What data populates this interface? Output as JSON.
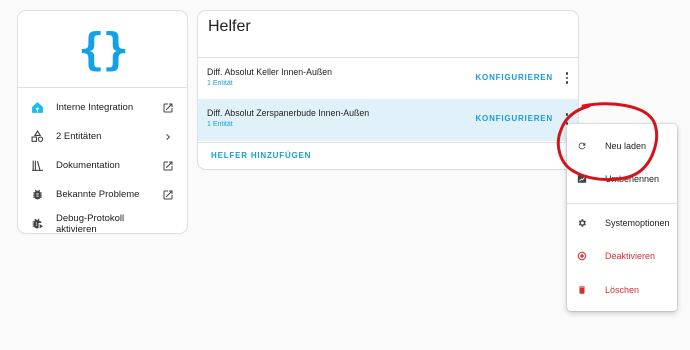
{
  "left_card": {
    "logo_text": "{}",
    "items": [
      {
        "label": "Interne Integration",
        "icon": "home-assistant-icon",
        "trailing": "open-external-icon"
      },
      {
        "label": "2 Entitäten",
        "icon": "shapes-icon",
        "trailing": "chevron-right-icon"
      },
      {
        "label": "Dokumentation",
        "icon": "book-icon",
        "trailing": "open-external-icon"
      },
      {
        "label": "Bekannte Probleme",
        "icon": "bug-icon",
        "trailing": "open-external-icon"
      },
      {
        "label": "Debug-Protokoll aktivieren",
        "icon": "bug-play-icon",
        "trailing": ""
      }
    ]
  },
  "main_card": {
    "title": "Helfer",
    "rows": [
      {
        "name": "Diff. Absolut Keller Innen-Außen",
        "count": "1 Entität",
        "action": "KONFIGURIEREN"
      },
      {
        "name": "Diff. Absolut Zerspanerbude Innen-Außen",
        "count": "1 Entität",
        "action": "KONFIGURIEREN"
      }
    ],
    "add_label": "HELFER HINZUFÜGEN"
  },
  "menu": {
    "items": [
      {
        "label": "Neu laden",
        "icon": "reload-icon"
      },
      {
        "label": "Umbenennen",
        "icon": "rename-icon"
      },
      {
        "label": "Systemoptionen",
        "icon": "gear-icon"
      },
      {
        "label": "Deaktivieren",
        "icon": "disable-icon"
      },
      {
        "label": "Löschen",
        "icon": "trash-icon"
      }
    ]
  },
  "colors": {
    "accent": "#1a9be0",
    "logo": "#12a0e8",
    "danger": "#d32f2f",
    "selected_row": "#e1f1fa",
    "annotation": "#d4141b"
  }
}
